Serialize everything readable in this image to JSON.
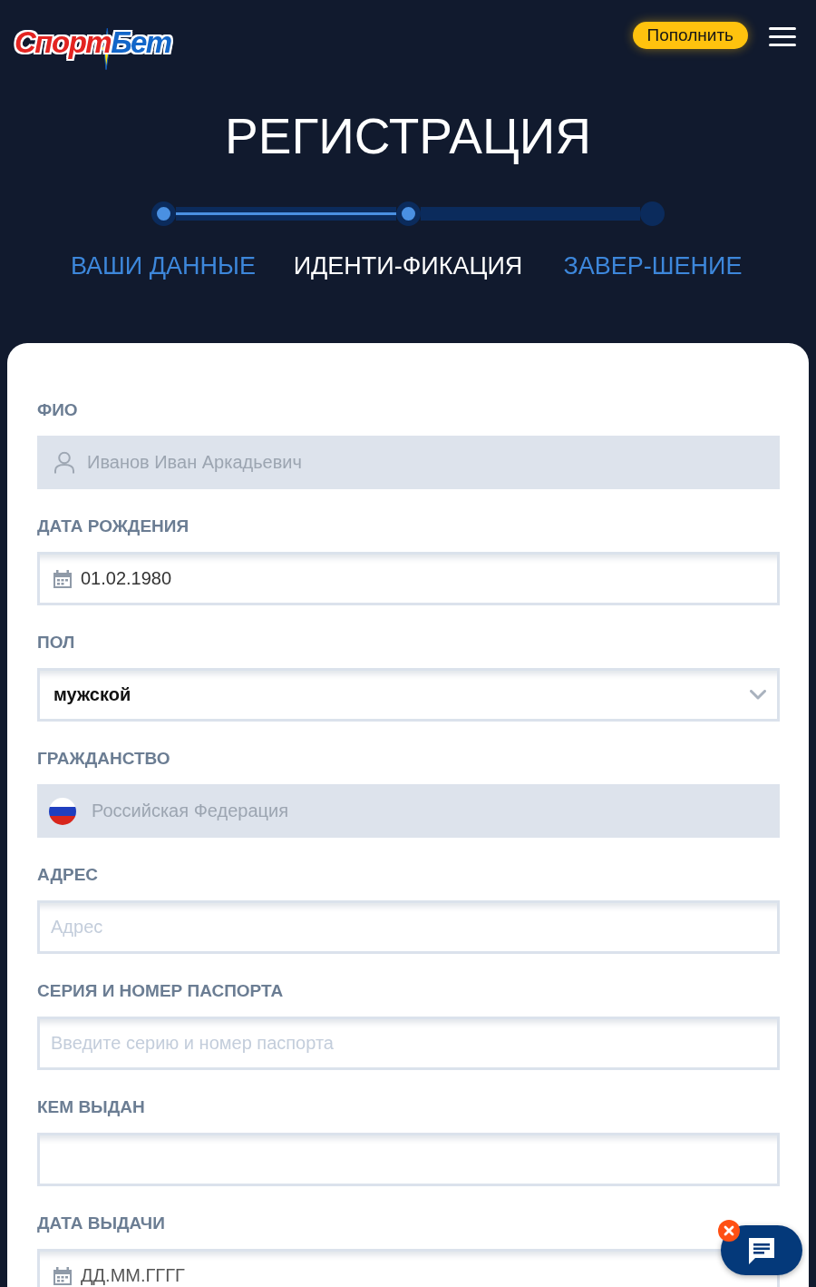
{
  "header": {
    "logo": [
      "Спорт",
      "Бет"
    ],
    "deposit_button": "Пополнить"
  },
  "title": "РЕГИСТРАЦИЯ",
  "steps": [
    {
      "label": "ВАШИ ДАННЫЕ",
      "reached": true,
      "selected": false
    },
    {
      "label": "ИДЕНТИ-ФИКАЦИЯ",
      "reached": true,
      "selected": true
    },
    {
      "label": "ЗАВЕР-ШЕНИЕ",
      "reached": false,
      "selected": false
    }
  ],
  "form": {
    "fields": [
      {
        "label": "ФИО",
        "kind": "name",
        "value": "Иванов Иван Аркадьевич",
        "disabled": true
      },
      {
        "label": "ДАТА РОЖДЕНИЯ",
        "kind": "date",
        "value": "01.02.1980",
        "disabled": false
      },
      {
        "label": "ПОЛ",
        "kind": "select",
        "value": "мужской",
        "disabled": false
      },
      {
        "label": "ГРАЖДАНСТВО",
        "kind": "country",
        "value": "Российская Федерация",
        "disabled": true
      },
      {
        "label": "АДРЕС",
        "kind": "text",
        "placeholder": "Адрес",
        "disabled": false
      },
      {
        "label": "СЕРИЯ И НОМЕР ПАСПОРТА",
        "kind": "text",
        "placeholder": "Введите серию и номер паспорта",
        "disabled": false
      },
      {
        "label": "КЕМ ВЫДАН",
        "kind": "text",
        "disabled": false
      },
      {
        "label": "ДАТА ВЫДАЧИ",
        "kind": "date",
        "placeholder": "ДД.ММ.ГГГГ",
        "disabled": false
      }
    ]
  }
}
